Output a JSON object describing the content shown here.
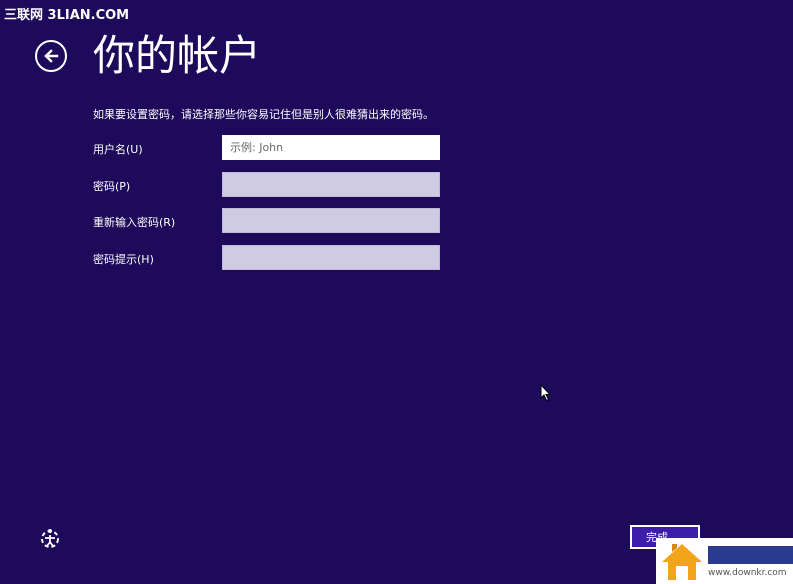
{
  "watermark_top": "三联网 3LIAN.COM",
  "header": {
    "title": "你的帐户"
  },
  "instruction": "如果要设置密码，请选择那些你容易记住但是别人很难猜出来的密码。",
  "form": {
    "username": {
      "label": "用户名(U)",
      "placeholder": "示例: John"
    },
    "password": {
      "label": "密码(P)"
    },
    "reenter": {
      "label": "重新输入密码(R)"
    },
    "hint": {
      "label": "密码提示(H)"
    }
  },
  "footer": {
    "finish_label": "完成"
  },
  "watermark_bottom": {
    "url": "www.downkr.com"
  },
  "colors": {
    "background": "#1e0a5a",
    "button": "#3d1ea8",
    "inactive_input": "#cfcbe2"
  },
  "icons": {
    "back": "back-arrow-icon",
    "ease_of_access": "ease-of-access-icon",
    "cursor": "mouse-pointer-icon"
  }
}
